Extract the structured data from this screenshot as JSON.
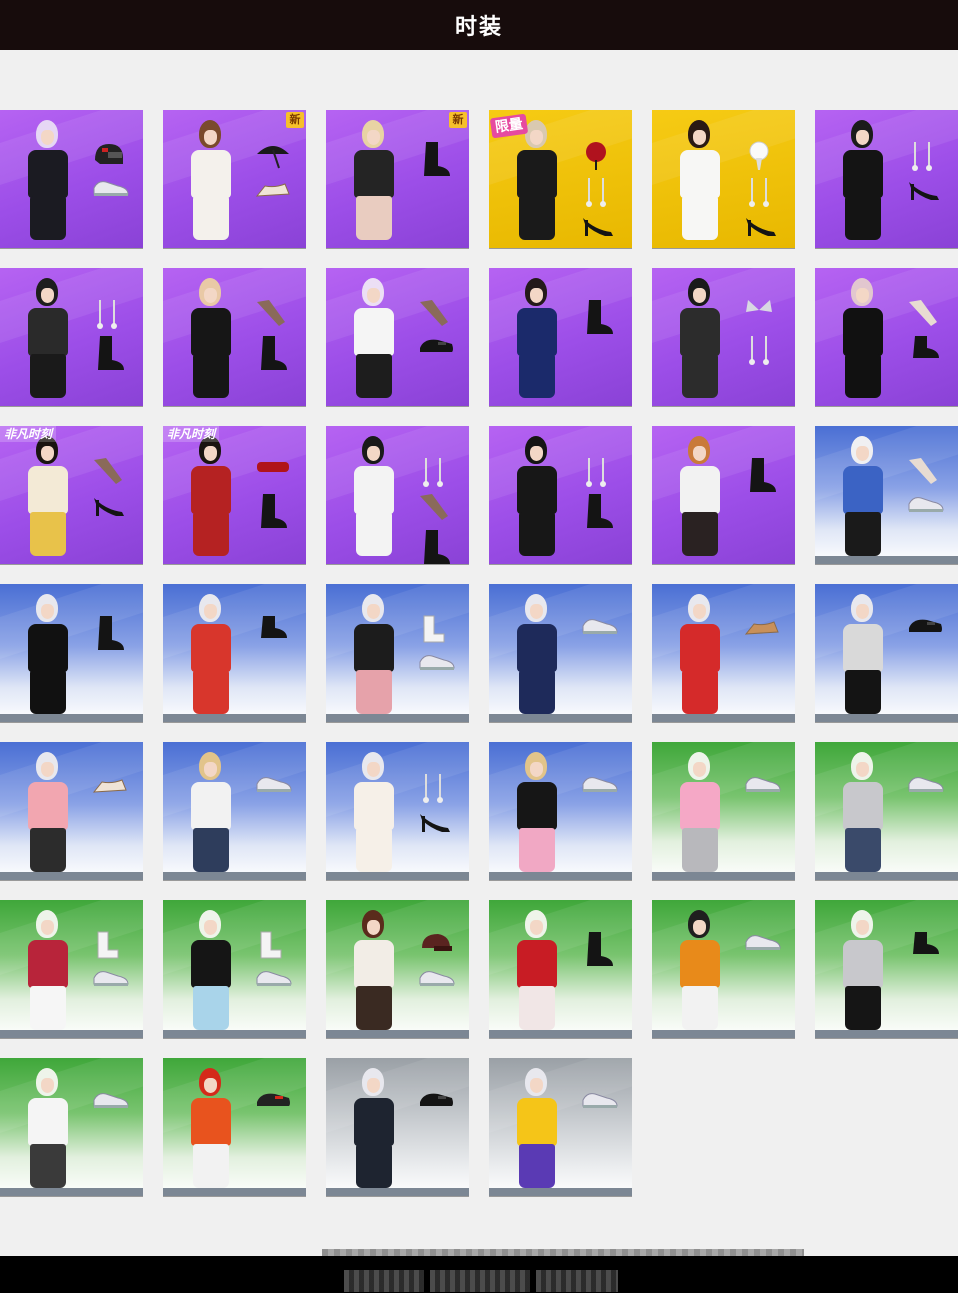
{
  "header": {
    "title": "时装"
  },
  "colors": {
    "header_bg": "#170c0c",
    "page_bg": "#f0f0f0",
    "purple": "#a557ee",
    "yellow": "#f2c40a",
    "blue": "#4a6fd4",
    "green": "#3fa73a",
    "gray": "#a6acb2"
  },
  "badges": {
    "new": "新",
    "limited": "限量",
    "event": "非凡时刻"
  },
  "outfits": [
    {
      "bg": "purple",
      "hair": "#e6d7f5",
      "top": "#1b1b22",
      "bottom": "#1b1b22",
      "items": [
        "helmet-icon",
        "sneaker-icon"
      ]
    },
    {
      "bg": "purple",
      "hair": "#7a4a2c",
      "top": "#f4f1ec",
      "bottom": "#f4f1ec",
      "badge": "new",
      "items": [
        "umbrella-icon",
        "sandal-icon"
      ]
    },
    {
      "bg": "purple",
      "hair": "#e8d3a4",
      "top": "#242424",
      "bottom": "#e9ccc0",
      "badge": "new",
      "items": [
        "boot-icon"
      ]
    },
    {
      "bg": "yellow",
      "hair": "#d9c9b0",
      "top": "#1a1a1a",
      "bottom": "#1a1a1a",
      "badge": "limited",
      "items": [
        "rose-icon",
        "earring-icon",
        "heel-icon"
      ]
    },
    {
      "bg": "yellow",
      "hair": "#2a1a14",
      "top": "#f7f7f5",
      "bottom": "#f7f7f5",
      "items": [
        "bouquet-icon",
        "earring-icon",
        "heel-icon"
      ]
    },
    {
      "bg": "purple",
      "hair": "#1b1b1b",
      "top": "#141414",
      "bottom": "#141414",
      "items": [
        "earring-icon",
        "heel-icon"
      ]
    },
    {
      "bg": "purple",
      "hair": "#1e1e1e",
      "top": "#2a2a2a",
      "bottom": "#1a1a1a",
      "items": [
        "earring-icon",
        "boot-icon"
      ]
    },
    {
      "bg": "purple",
      "hair": "#e9c9a6",
      "top": "#161616",
      "bottom": "#161616",
      "items": [
        "stocking-icon",
        "boot-icon"
      ]
    },
    {
      "bg": "purple",
      "hair": "#ecdff5",
      "top": "#f5f5f5",
      "bottom": "#1d1d1d",
      "items": [
        "stocking-icon",
        "loafer-icon"
      ]
    },
    {
      "bg": "purple",
      "hair": "#241a1a",
      "top": "#1b2a6b",
      "bottom": "#1b2a6b",
      "items": [
        "boot-icon"
      ]
    },
    {
      "bg": "purple",
      "hair": "#1a1a1a",
      "top": "#2c2c2c",
      "bottom": "#2c2c2c",
      "items": [
        "butterfly-icon",
        "earring-icon"
      ]
    },
    {
      "bg": "purple",
      "hair": "#e2c7cf",
      "top": "#111111",
      "bottom": "#111111",
      "items": [
        "glove-icon",
        "platform-shoe-icon"
      ]
    },
    {
      "bg": "purple",
      "hair": "#1a1410",
      "top": "#f3ead6",
      "bottom": "#e8c24a",
      "badge": "event",
      "items": [
        "stocking-icon",
        "heel-icon"
      ]
    },
    {
      "bg": "purple",
      "hair": "#1a1410",
      "top": "#b52222",
      "bottom": "#b52222",
      "badge": "event",
      "items": [
        "headband-icon",
        "boot-icon"
      ]
    },
    {
      "bg": "purple",
      "hair": "#1a1a1a",
      "top": "#f3f3f3",
      "bottom": "#f3f3f3",
      "items": [
        "earring-icon",
        "stocking-icon",
        "boot-icon"
      ]
    },
    {
      "bg": "purple",
      "hair": "#151515",
      "top": "#171717",
      "bottom": "#171717",
      "items": [
        "earring-icon",
        "boot-icon"
      ]
    },
    {
      "bg": "purple",
      "hair": "#c97a3a",
      "top": "#f2f2f2",
      "bottom": "#2a2222",
      "items": [
        "boot-icon"
      ]
    },
    {
      "bg": "blue",
      "hair": "#f0f0f2",
      "top": "#3b63c4",
      "bottom": "#1a1a1a",
      "items": [
        "glove-icon",
        "sneaker-icon"
      ]
    },
    {
      "bg": "blue",
      "hair": "#e8e8ee",
      "top": "#111111",
      "bottom": "#111111",
      "items": [
        "boot-icon"
      ]
    },
    {
      "bg": "blue",
      "hair": "#e8e8ee",
      "top": "#d8362c",
      "bottom": "#d8362c",
      "items": [
        "ankle-boot-icon"
      ]
    },
    {
      "bg": "blue",
      "hair": "#e8e8ee",
      "top": "#1c1c1c",
      "bottom": "#e6a2aa",
      "items": [
        "sock-icon",
        "sneaker-icon"
      ]
    },
    {
      "bg": "blue",
      "hair": "#e8e8ee",
      "top": "#1e2a5a",
      "bottom": "#1e2a5a",
      "items": [
        "sneaker-icon"
      ]
    },
    {
      "bg": "blue",
      "hair": "#e8e8ee",
      "top": "#d52a2a",
      "bottom": "#d52a2a",
      "items": [
        "wedge-icon"
      ]
    },
    {
      "bg": "blue",
      "hair": "#e8e8ee",
      "top": "#d9d9d9",
      "bottom": "#141414",
      "items": [
        "loafer-icon"
      ]
    },
    {
      "bg": "blue",
      "hair": "#e8e8ee",
      "top": "#f2a6b0",
      "bottom": "#2c2c2c",
      "items": [
        "sandal-icon"
      ]
    },
    {
      "bg": "blue",
      "hair": "#e2c48a",
      "top": "#f2f2f2",
      "bottom": "#2e3d5c",
      "items": [
        "sneaker-icon"
      ]
    },
    {
      "bg": "blue",
      "hair": "#e8e8ee",
      "top": "#f6f0e8",
      "bottom": "#f6f0e8",
      "items": [
        "earring-icon",
        "heel-icon"
      ]
    },
    {
      "bg": "blue",
      "hair": "#e2c48a",
      "top": "#161616",
      "bottom": "#f1a8c4",
      "items": [
        "sneaker-icon"
      ]
    },
    {
      "bg": "green",
      "hair": "#eef4ea",
      "top": "#f5a8c6",
      "bottom": "#b8b8bc",
      "items": [
        "sneaker-icon"
      ]
    },
    {
      "bg": "green",
      "hair": "#eef4ea",
      "top": "#c8c8cc",
      "bottom": "#3a4a6a",
      "items": [
        "sneaker-icon"
      ]
    },
    {
      "bg": "green",
      "hair": "#eef4ea",
      "top": "#b8243a",
      "bottom": "#f6f6f6",
      "items": [
        "sock-icon",
        "sneaker-icon"
      ]
    },
    {
      "bg": "green",
      "hair": "#eef4ea",
      "top": "#151515",
      "bottom": "#a9d4ea",
      "items": [
        "sock-icon",
        "sneaker-icon"
      ]
    },
    {
      "bg": "green",
      "hair": "#5a2c1c",
      "top": "#f2ede6",
      "bottom": "#3a2a22",
      "items": [
        "cap-icon",
        "sneaker-icon"
      ]
    },
    {
      "bg": "green",
      "hair": "#eef4ea",
      "top": "#c81c24",
      "bottom": "#f1e6e6",
      "items": [
        "boot-icon"
      ]
    },
    {
      "bg": "green",
      "hair": "#1f1f1f",
      "top": "#e88a1a",
      "bottom": "#f2f2f2",
      "items": [
        "sneaker-icon"
      ]
    },
    {
      "bg": "green",
      "hair": "#eef4ea",
      "top": "#c8c8cc",
      "bottom": "#151515",
      "items": [
        "ankle-boot-icon"
      ]
    },
    {
      "bg": "green",
      "hair": "#eef4ea",
      "top": "#f5f5f5",
      "bottom": "#3a3a3a",
      "items": [
        "sneaker-icon"
      ]
    },
    {
      "bg": "green",
      "hair": "#d42a1a",
      "top": "#e8531e",
      "bottom": "#f2f2f2",
      "items": [
        "racing-shoe-icon"
      ]
    },
    {
      "bg": "gray",
      "hair": "#e8e8ee",
      "top": "#1e2430",
      "bottom": "#1e2430",
      "items": [
        "loafer-icon"
      ]
    },
    {
      "bg": "gray",
      "hair": "#e8e8ee",
      "top": "#f5c518",
      "bottom": "#5a3ab4",
      "items": [
        "sneaker-icon"
      ]
    }
  ]
}
